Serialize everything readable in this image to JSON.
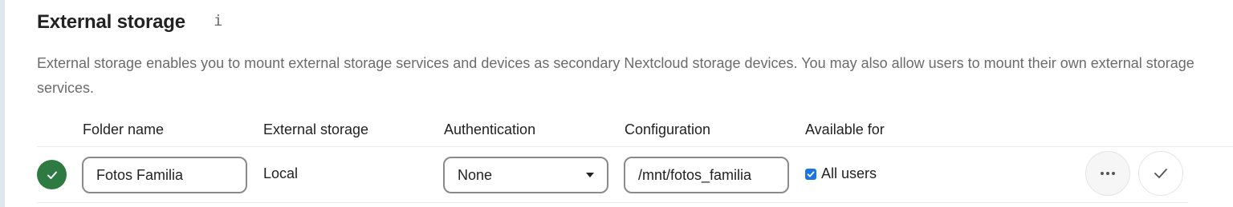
{
  "section": {
    "title": "External storage",
    "info_icon": "info-icon",
    "description": "External storage enables you to mount external storage services and devices as secondary Nextcloud storage devices. You may also allow users to mount their own external storage services."
  },
  "table": {
    "headers": {
      "folder_name": "Folder name",
      "external_storage": "External storage",
      "authentication": "Authentication",
      "configuration": "Configuration",
      "available_for": "Available for"
    },
    "rows": [
      {
        "status_icon": "check-circle-icon",
        "folder_name": "Fotos Familia",
        "external_storage": "Local",
        "authentication": "None",
        "configuration": "/mnt/fotos_familia",
        "available_for_checked": true,
        "available_for_label": "All users",
        "actions": [
          "more-icon",
          "checkmark-icon"
        ]
      }
    ]
  },
  "colors": {
    "status_ok": "#2d7b43",
    "checkbox": "#1a73e8",
    "muted_text": "#6b6b6b"
  }
}
